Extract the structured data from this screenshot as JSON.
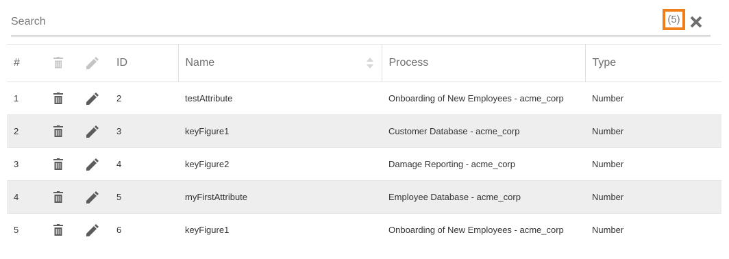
{
  "search": {
    "placeholder": "Search",
    "value": "",
    "count": "(5)"
  },
  "columns": {
    "index": "#",
    "id": "ID",
    "name": "Name",
    "process": "Process",
    "type": "Type"
  },
  "colors": {
    "highlight": "#f07f1a",
    "row_alt": "#eeeeee"
  },
  "rows": [
    {
      "index": "1",
      "id": "2",
      "name": "testAttribute",
      "process": "Onboarding of New Employees - acme_corp",
      "type": "Number"
    },
    {
      "index": "2",
      "id": "3",
      "name": "keyFigure1",
      "process": "Customer Database - acme_corp",
      "type": "Number"
    },
    {
      "index": "3",
      "id": "4",
      "name": "keyFigure2",
      "process": "Damage Reporting - acme_corp",
      "type": "Number"
    },
    {
      "index": "4",
      "id": "5",
      "name": "myFirstAttribute",
      "process": "Employee Database - acme_corp",
      "type": "Number"
    },
    {
      "index": "5",
      "id": "6",
      "name": "keyFigure1",
      "process": "Onboarding of New Employees - acme_corp",
      "type": "Number"
    }
  ]
}
